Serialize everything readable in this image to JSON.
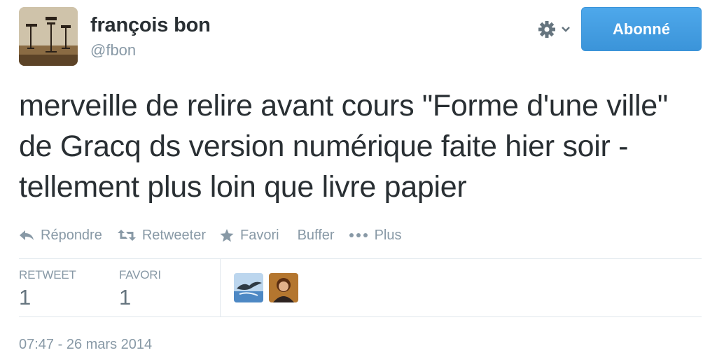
{
  "user": {
    "name": "françois bon",
    "handle": "@fbon",
    "avatar_icon": "user-avatar-chairs"
  },
  "header": {
    "gear_icon": "gear-icon",
    "follow_label": "Abonné"
  },
  "tweet": {
    "text": "merveille de relire avant cours \"Forme d'une ville\" de Gracq ds version numérique faite hier soir - tellement plus loin que livre papier"
  },
  "actions": {
    "reply_label": "Répondre",
    "retweet_label": "Retweeter",
    "favorite_label": "Favori",
    "buffer_label": "Buffer",
    "more_label": "Plus"
  },
  "stats": {
    "retweets_label": "RETWEET",
    "retweets_count": "1",
    "favorites_label": "FAVORI",
    "favorites_count": "1"
  },
  "favoriters": [
    "avatar-bird",
    "avatar-person"
  ],
  "timestamp": "07:47 - 26 mars 2014",
  "colors": {
    "accent": "#3b94d9",
    "text": "#292f33",
    "secondary": "#8899a6",
    "divider": "#e1e8ed"
  }
}
